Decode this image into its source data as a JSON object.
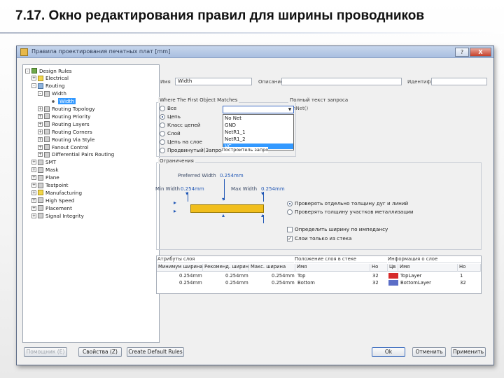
{
  "slide": {
    "title": "7.17. Окно редактирования правил для ширины проводников"
  },
  "dialog": {
    "title": "Правила проектирования печатных плат [mm]",
    "help_btn": "?",
    "close_btn": "X"
  },
  "tree": {
    "items": [
      {
        "label": "Design Rules",
        "level": 0,
        "exp": "-",
        "icon": "db"
      },
      {
        "label": "Electrical",
        "level": 1,
        "exp": "+",
        "icon": "el"
      },
      {
        "label": "Routing",
        "level": 1,
        "exp": "-",
        "icon": "ro"
      },
      {
        "label": "Width",
        "level": 2,
        "exp": "-",
        "icon": "gr"
      },
      {
        "label": "Width",
        "level": 3,
        "exp": "",
        "icon": "dot",
        "selected": true
      },
      {
        "label": "Routing Topology",
        "level": 2,
        "exp": "+",
        "icon": "gr"
      },
      {
        "label": "Routing Priority",
        "level": 2,
        "exp": "+",
        "icon": "gr"
      },
      {
        "label": "Routing Layers",
        "level": 2,
        "exp": "+",
        "icon": "gr"
      },
      {
        "label": "Routing Corners",
        "level": 2,
        "exp": "+",
        "icon": "gr"
      },
      {
        "label": "Routing Via Style",
        "level": 2,
        "exp": "+",
        "icon": "gr"
      },
      {
        "label": "Fanout Control",
        "level": 2,
        "exp": "+",
        "icon": "gr"
      },
      {
        "label": "Differential Pairs Routing",
        "level": 2,
        "exp": "+",
        "icon": "gr"
      },
      {
        "label": "SMT",
        "level": 1,
        "exp": "+",
        "icon": "gr"
      },
      {
        "label": "Mask",
        "level": 1,
        "exp": "+",
        "icon": "gr"
      },
      {
        "label": "Plane",
        "level": 1,
        "exp": "+",
        "icon": "gr"
      },
      {
        "label": "Testpoint",
        "level": 1,
        "exp": "+",
        "icon": "gr"
      },
      {
        "label": "Manufacturing",
        "level": 1,
        "exp": "+",
        "icon": "el"
      },
      {
        "label": "High Speed",
        "level": 1,
        "exp": "+",
        "icon": "gr"
      },
      {
        "label": "Placement",
        "level": 1,
        "exp": "+",
        "icon": "gr"
      },
      {
        "label": "Signal Integrity",
        "level": 1,
        "exp": "+",
        "icon": "gr"
      }
    ]
  },
  "rule": {
    "name_label": "Имя",
    "name_value": "Width",
    "comment_label": "Описание",
    "comment_value": "",
    "id_label": "Идентиф",
    "id_value": ""
  },
  "where": {
    "title": "Where The First Object Matches",
    "options": [
      {
        "label": "Все",
        "checked": false
      },
      {
        "label": "Цепь",
        "checked": true
      },
      {
        "label": "Класс цепей",
        "checked": false
      },
      {
        "label": "Слой",
        "checked": false
      },
      {
        "label": "Цепь на слое",
        "checked": false
      },
      {
        "label": "Продвинутый(Запрос)",
        "checked": false
      }
    ],
    "dropdown_items": [
      "No Net",
      "GND",
      "NetR1_1",
      "NetR1_2",
      "VC"
    ],
    "query_builder": "Построитель запроса"
  },
  "query": {
    "title": "Полный текст запроса",
    "text": "InNet()"
  },
  "constraints": {
    "title": "Ограничения",
    "preferred_label": "Preferred Width",
    "preferred_value": "0.254mm",
    "min_label": "Min Width",
    "min_value": "0.254mm",
    "max_label": "Max Width",
    "max_value": "0.254mm",
    "radio_options": [
      {
        "label": "Проверять отдельно толщину дуг и линий",
        "checked": true
      },
      {
        "label": "Проверять толщину участков металлизации",
        "checked": false
      }
    ],
    "check_options": [
      {
        "label": "Определить ширину по импедансу",
        "checked": false
      },
      {
        "label": "Слои только из стека",
        "checked": true
      }
    ]
  },
  "table": {
    "group_headers": [
      "Атрибуты слоя",
      "Положение слоя в стеке",
      "Информация о слое"
    ],
    "headers": [
      "Минимум ширина",
      "Рекоменд. ширин",
      "Макс. ширина",
      "Имя",
      "Но",
      "Цв",
      "Имя",
      "Но"
    ],
    "rows": [
      [
        "0.254mm",
        "0.254mm",
        "0.254mm",
        "Top",
        "32",
        "",
        "TopLayer",
        "1"
      ],
      [
        "0.254mm",
        "0.254mm",
        "0.254mm",
        "Bottom",
        "32",
        "",
        "BottomLayer",
        "32"
      ]
    ],
    "colors": [
      "#d62b2b",
      "#5b6ec7"
    ]
  },
  "buttons": {
    "help": "Помощник (E)",
    "properties": "Свойства (Z)",
    "defaults": "Create Default Rules",
    "ok": "Ok",
    "cancel": "Отменить",
    "apply": "Применить"
  }
}
